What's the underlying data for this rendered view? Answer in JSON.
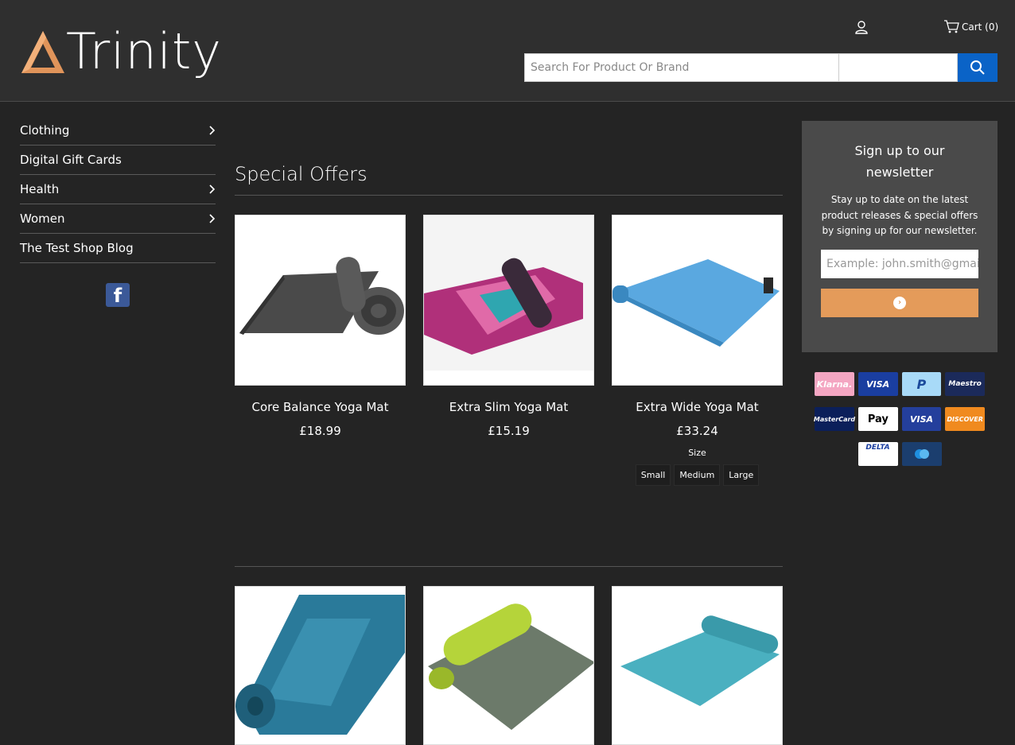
{
  "header": {
    "logo_text": "Trinity",
    "cart_label": "Cart (0)",
    "search_placeholder": "Search For Product Or Brand"
  },
  "sidebar": {
    "items": [
      {
        "label": "Clothing",
        "has_submenu": true
      },
      {
        "label": "Digital Gift Cards",
        "has_submenu": false
      },
      {
        "label": "Health",
        "has_submenu": true
      },
      {
        "label": "Women",
        "has_submenu": true
      },
      {
        "label": "The Test Shop Blog",
        "has_submenu": false
      }
    ],
    "social_icon": "facebook-icon"
  },
  "main": {
    "section_title": "Special Offers",
    "products": [
      {
        "name": "Core Balance Yoga Mat",
        "price": "£18.99",
        "mat_color": "#5a5a5a"
      },
      {
        "name": "Extra Slim Yoga Mat",
        "price": "£15.19",
        "mat_color": "#b0307a"
      },
      {
        "name": "Extra Wide Yoga Mat",
        "price": "£33.24",
        "mat_color": "#5aa8e0",
        "size_label": "Size",
        "sizes": [
          "Small",
          "Medium",
          "Large"
        ]
      }
    ],
    "products_row2": [
      {
        "mat_color": "#2a6a8a"
      },
      {
        "mat_color": "#6c7a6a"
      },
      {
        "mat_color": "#4ab0c0"
      }
    ]
  },
  "newsletter": {
    "title": "Sign up to our newsletter",
    "description": "Stay up to date on the latest product releases & special offers by signing up for our newsletter.",
    "email_placeholder": "Example: john.smith@gmail.com"
  },
  "payments": {
    "row1": [
      {
        "label": "Klarna.",
        "bg": "#f4a6c2",
        "fg": "#ffffff"
      },
      {
        "label": "VISA",
        "bg": "#1a3ea0",
        "fg": "#ffffff"
      },
      {
        "label": "P",
        "bg": "#a8daf8",
        "fg": "#1b4a9c"
      },
      {
        "label": "Maestro",
        "bg": "#1b2a5a",
        "fg": "#ffffff"
      }
    ],
    "row2": [
      {
        "label": "MasterCard",
        "bg": "#0b1f5a",
        "fg": "#ffffff"
      },
      {
        "label": "Pay",
        "bg": "#ffffff",
        "fg": "#000000"
      },
      {
        "label": "VISA",
        "bg": "#243f9c",
        "fg": "#ffffff"
      },
      {
        "label": "DISCOVER",
        "bg": "#f08a1f",
        "fg": "#ffffff"
      }
    ],
    "row3": [
      {
        "label": "DELTA",
        "bg": "#ffffff",
        "fg": "#1a3ea0"
      },
      {
        "label": "",
        "bg": "#1b3e6e",
        "fg": "#ffffff"
      }
    ]
  },
  "colors": {
    "header_bg": "#2f2f2f",
    "page_bg": "#242424",
    "search_button": "#0a63c7",
    "newsletter_bg": "#4a4a4a",
    "subscribe_button": "#e49b5a"
  }
}
